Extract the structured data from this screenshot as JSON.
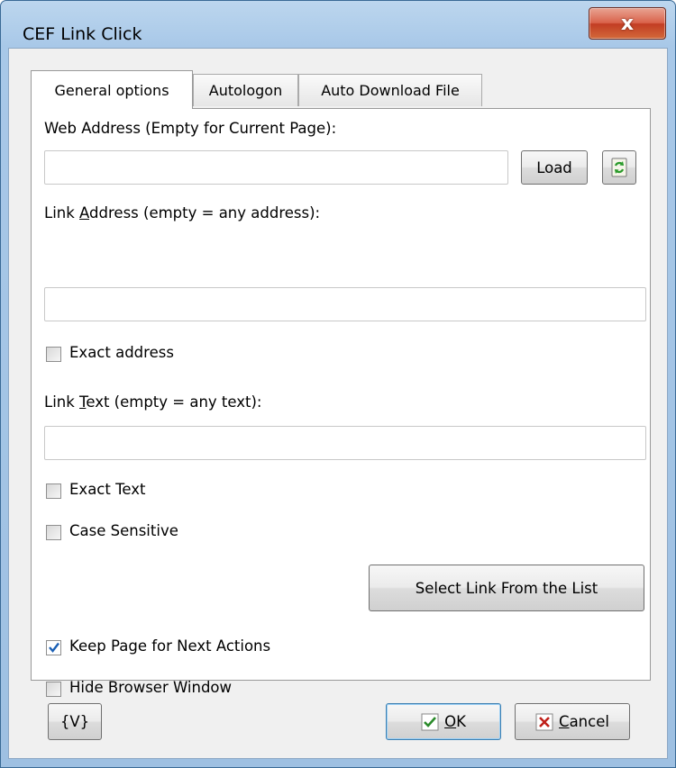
{
  "window": {
    "title": "CEF Link Click",
    "close_glyph": "x"
  },
  "tabs": [
    {
      "label": "General options",
      "active": true
    },
    {
      "label": "Autologon",
      "active": false
    },
    {
      "label": "Auto Download File",
      "active": false
    }
  ],
  "general": {
    "web_address_label": "Web Address (Empty for Current Page):",
    "web_address_value": "",
    "load_label": "Load",
    "refresh_icon": "refresh-icon",
    "link_address_label_pre": "Link ",
    "link_address_label_accel": "A",
    "link_address_label_post": "ddress (empty = any address):",
    "link_address_value": "",
    "exact_address_label": "Exact address",
    "exact_address_checked": false,
    "link_text_label_pre": "Link ",
    "link_text_label_accel": "T",
    "link_text_label_post": "ext (empty = any text):",
    "link_text_value": "",
    "exact_text_label": "Exact Text",
    "exact_text_checked": false,
    "case_sensitive_label": "Case Sensitive",
    "case_sensitive_checked": false,
    "select_link_label": "Select Link From the List",
    "keep_page_label": "Keep Page for Next Actions",
    "keep_page_checked": true,
    "hide_browser_label": "Hide Browser Window",
    "hide_browser_checked": false
  },
  "footer": {
    "variables_label": "{V}",
    "ok_accel": "O",
    "ok_rest": "K",
    "cancel_accel": "C",
    "cancel_rest": "ancel"
  },
  "colors": {
    "accent_check": "#1a5fb4",
    "ok_icon": "#2a8a2a",
    "cancel_icon": "#c0201a"
  }
}
